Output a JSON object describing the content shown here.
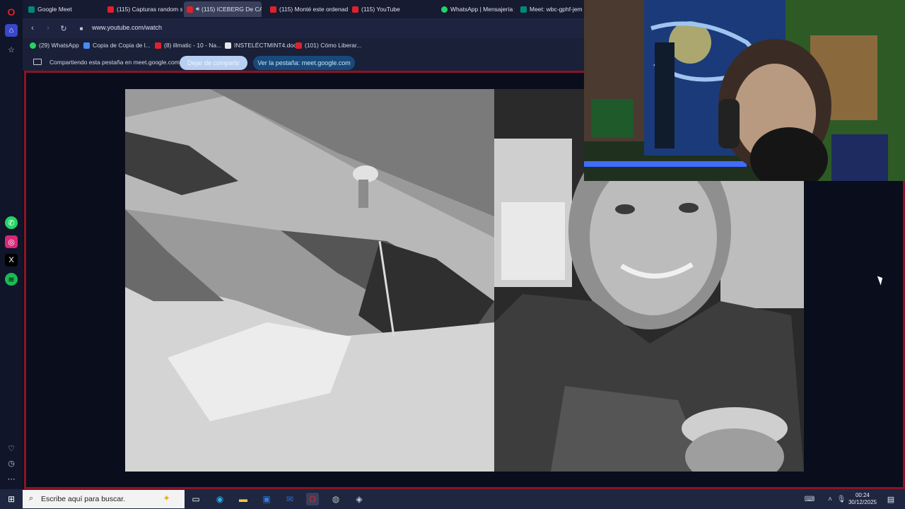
{
  "browser": {
    "tabs": [
      {
        "label": "Google Meet",
        "icon": "meet-icon",
        "active": false
      },
      {
        "label": "(115) Capturas random si",
        "icon": "youtube-icon",
        "active": false
      },
      {
        "label": "(115) ICEBERG De CA",
        "icon": "youtube-icon",
        "active": true
      },
      {
        "label": "(115) Monté este ordenad",
        "icon": "youtube-icon",
        "active": false
      },
      {
        "label": "(115) YouTube",
        "icon": "youtube-icon",
        "active": false
      },
      {
        "label": "WhatsApp | Mensajería y",
        "icon": "whatsapp-icon",
        "active": false
      },
      {
        "label": "Meet: wbc-gphf-jem",
        "icon": "meet-icon",
        "active": false
      }
    ],
    "url": "www.youtube.com/watch",
    "bookmarks": [
      {
        "label": "(29) WhatsApp",
        "icon": "whatsapp-icon"
      },
      {
        "label": "Copia de Copia de l...",
        "icon": "doc-icon"
      },
      {
        "label": "(8) illmatic - 10 - Na...",
        "icon": "youtube-icon"
      },
      {
        "label": "INSTELÉCTMINT4.doc",
        "icon": "file-icon"
      },
      {
        "label": "(101) Cómo Liberar...",
        "icon": "youtube-icon"
      }
    ],
    "share_bar": {
      "text": "Compartiendo esta pestaña en meet.google.com",
      "stop_label": "Dejar de compartir",
      "goto_label": "Ver la pestaña: meet.google.com"
    }
  },
  "taskbar": {
    "search_placeholder": "Escribe aquí para buscar.",
    "time": "00:24",
    "date": "30/12/2025"
  },
  "colors": {
    "accent_border": "#8a1424",
    "youtube_red": "#e0212b",
    "whatsapp_green": "#25d366"
  }
}
